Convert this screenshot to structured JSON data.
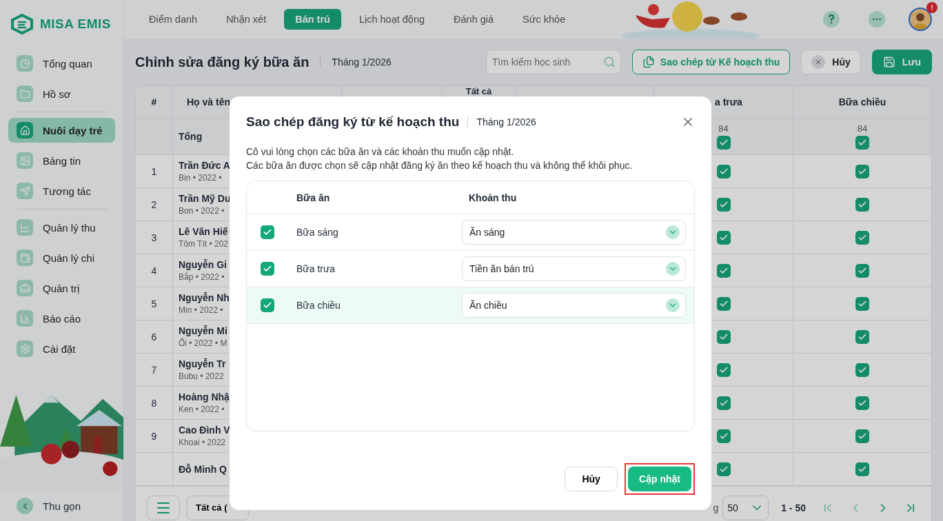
{
  "sidebar": {
    "logo": "MISA EMIS",
    "items": [
      {
        "kind": "item",
        "label": "Tổng quan",
        "selected": false
      },
      {
        "kind": "item",
        "label": "Hồ sơ",
        "selected": false
      },
      {
        "kind": "divider"
      },
      {
        "kind": "item",
        "label": "Nuôi dạy trẻ",
        "selected": true
      },
      {
        "kind": "item",
        "label": "Bảng tin",
        "selected": false
      },
      {
        "kind": "item",
        "label": "Tương tác",
        "selected": false
      },
      {
        "kind": "divider"
      },
      {
        "kind": "item",
        "label": "Quản lý thu",
        "selected": false
      },
      {
        "kind": "item",
        "label": "Quản lý chi",
        "selected": false
      },
      {
        "kind": "item",
        "label": "Quản trị",
        "selected": false
      },
      {
        "kind": "item",
        "label": "Báo cáo",
        "selected": false
      },
      {
        "kind": "item",
        "label": "Cài đặt",
        "selected": false
      }
    ],
    "collapse": "Thu gọn"
  },
  "tabs": [
    {
      "label": "Điểm danh",
      "selected": false
    },
    {
      "label": "Nhận xét",
      "selected": false
    },
    {
      "label": "Bán trú",
      "selected": true
    },
    {
      "label": "Lịch hoạt động",
      "selected": false
    },
    {
      "label": "Đánh giá",
      "selected": false
    },
    {
      "label": "Sức khỏe",
      "selected": false
    }
  ],
  "user": {
    "badge": "!"
  },
  "page_header": {
    "title": "Chỉnh sửa đăng ký bữa ăn",
    "period": "Tháng 1/2026",
    "search": {
      "placeholder": "Tìm kiếm học sinh"
    },
    "copy_button": "Sao chép từ Kế hoạch thu",
    "cancel_button": "Hủy",
    "save_button": "Lưu"
  },
  "table": {
    "columns": [
      "#",
      "Họ và tên",
      "Tất cả",
      "a trưa",
      "Bữa chiều"
    ],
    "totals": {
      "label": "Tổng",
      "lunch": {
        "count": "84",
        "checked": true
      },
      "dinner": {
        "count": "84",
        "checked": true
      }
    },
    "rows": [
      {
        "number": "1",
        "name": "Trần Đức A",
        "details": "Bin • 2022 •",
        "lunch": true,
        "dinner": true
      },
      {
        "number": "2",
        "name": "Trần Mỹ Du",
        "details": "Bon • 2022 •",
        "lunch": true,
        "dinner": true
      },
      {
        "number": "3",
        "name": "Lê Văn Hiế",
        "details": "Tôm Tít • 202",
        "lunch": true,
        "dinner": true
      },
      {
        "number": "4",
        "name": "Nguyễn Gi",
        "details": "Bắp • 2022 •",
        "lunch": true,
        "dinner": true
      },
      {
        "number": "5",
        "name": "Nguyễn Nh",
        "details": "Min • 2022 •",
        "lunch": true,
        "dinner": true
      },
      {
        "number": "6",
        "name": "Nguyễn Mi",
        "details": "Ổi • 2022 • M",
        "lunch": true,
        "dinner": true
      },
      {
        "number": "7",
        "name": "Nguyễn Tr",
        "details": "Bubu • 2022",
        "lunch": true,
        "dinner": true
      },
      {
        "number": "8",
        "name": "Hoàng Nhậ",
        "details": "Ken • 2022 •",
        "lunch": true,
        "dinner": true
      },
      {
        "number": "9",
        "name": "Cao Đình V",
        "details": "Khoai • 2022",
        "lunch": true,
        "dinner": true
      },
      {
        "name": "Đỗ Minh Q",
        "lunch": true,
        "dinner": true
      }
    ]
  },
  "footer": {
    "filter": "Tất cả (",
    "page_size_label": "g",
    "page_size": "50",
    "range": "1 - 50",
    "pager": [
      {
        "kind": "first",
        "disabled": true
      },
      {
        "kind": "prev",
        "disabled": true
      },
      {
        "kind": "next",
        "disabled": false
      },
      {
        "kind": "last",
        "disabled": false
      }
    ]
  },
  "modal": {
    "title": "Sao chép đăng ký từ kế hoạch thu",
    "period": "Tháng 1/2026",
    "description": [
      "Cô vui lòng chọn các bữa ăn và các khoản thu muốn cập nhật.",
      "Các bữa ăn được chọn sẽ cập nhật đăng ký ăn theo kế hoạch thu và không thể khôi phục."
    ],
    "columns": [
      "Bữa ăn",
      "Khoản thu"
    ],
    "rows": [
      {
        "meal": "Bữa sáng",
        "checked": true,
        "fee": "Ăn sáng",
        "highlighted": false
      },
      {
        "meal": "Bữa trưa",
        "checked": true,
        "fee": "Tiền ăn bán trú",
        "highlighted": false
      },
      {
        "meal": "Bữa chiều",
        "checked": true,
        "fee": "Ăn chiều",
        "highlighted": true
      }
    ],
    "cancel_button": "Hủy",
    "confirm_button": {
      "label": "Cập nhật",
      "highlighted": true
    }
  }
}
